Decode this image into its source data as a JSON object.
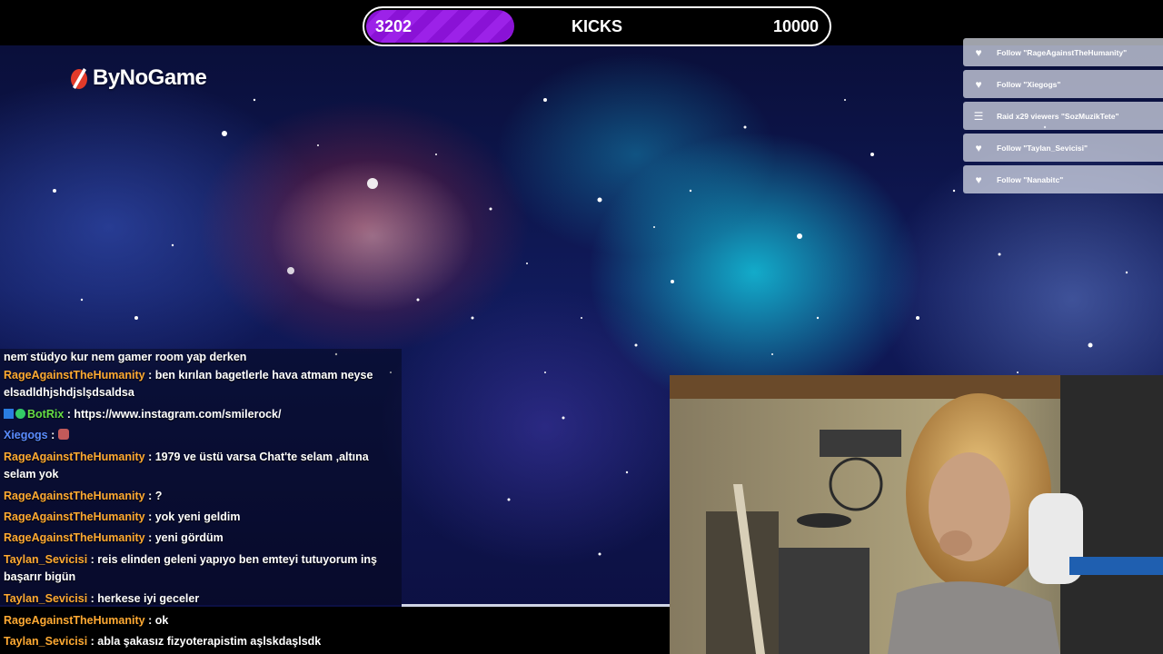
{
  "kicks": {
    "current": "3202",
    "label": "KICKS",
    "goal": "10000",
    "progress": 0.32
  },
  "logo": {
    "text": "ByNoGame"
  },
  "events": [
    {
      "icon": "heart-icon",
      "text": "Follow \"RageAgainstTheHumanity\""
    },
    {
      "icon": "heart-icon",
      "text": "Follow \"Xiegogs\""
    },
    {
      "icon": "raid-icon",
      "text": "Raid x29 viewers \"SozMuzikTete\""
    },
    {
      "icon": "heart-icon",
      "text": "Follow \"Taylan_Sevicisi\""
    },
    {
      "icon": "heart-icon",
      "text": "Follow \"Nanabitc\""
    }
  ],
  "chat": [
    {
      "user": "",
      "text": "nem stüdyo kur nem gamer room yap derken"
    },
    {
      "user": "RageAgainstTheHumanity",
      "text": " : ben kırılan bagetlerle hava atmam neyse elsadldhjshdjslşdsaldsa"
    },
    {
      "user": "BotRix",
      "text": " : https://www.instagram.com/smilerock/",
      "bot": true
    },
    {
      "user": "Xiegogs",
      "text": " : ",
      "emote": true
    },
    {
      "user": "RageAgainstTheHumanity",
      "text": " : 1979 ve üstü varsa Chat'te selam ,altına selam yok"
    },
    {
      "user": "RageAgainstTheHumanity",
      "text": " : ?"
    },
    {
      "user": "RageAgainstTheHumanity",
      "text": " : yok yeni geldim"
    },
    {
      "user": "RageAgainstTheHumanity",
      "text": " : yeni gördüm"
    },
    {
      "user": "Taylan_Sevicisi",
      "text": " : reis elinden geleni yapıyo ben emteyi tutuyorum inş başarır bigün"
    },
    {
      "user": "Taylan_Sevicisi",
      "text": " : herkese iyi geceler"
    },
    {
      "user": "RageAgainstTheHumanity",
      "text": " : ok"
    },
    {
      "user": "Taylan_Sevicisi",
      "text": " : abla şakasız fizyoterapistim aşlskdaşlsdk"
    }
  ],
  "colors": {
    "accent": "#9c22e8",
    "username": "#ffaa33",
    "bot_username": "#66dd44",
    "blue_username": "#5a8cff"
  }
}
